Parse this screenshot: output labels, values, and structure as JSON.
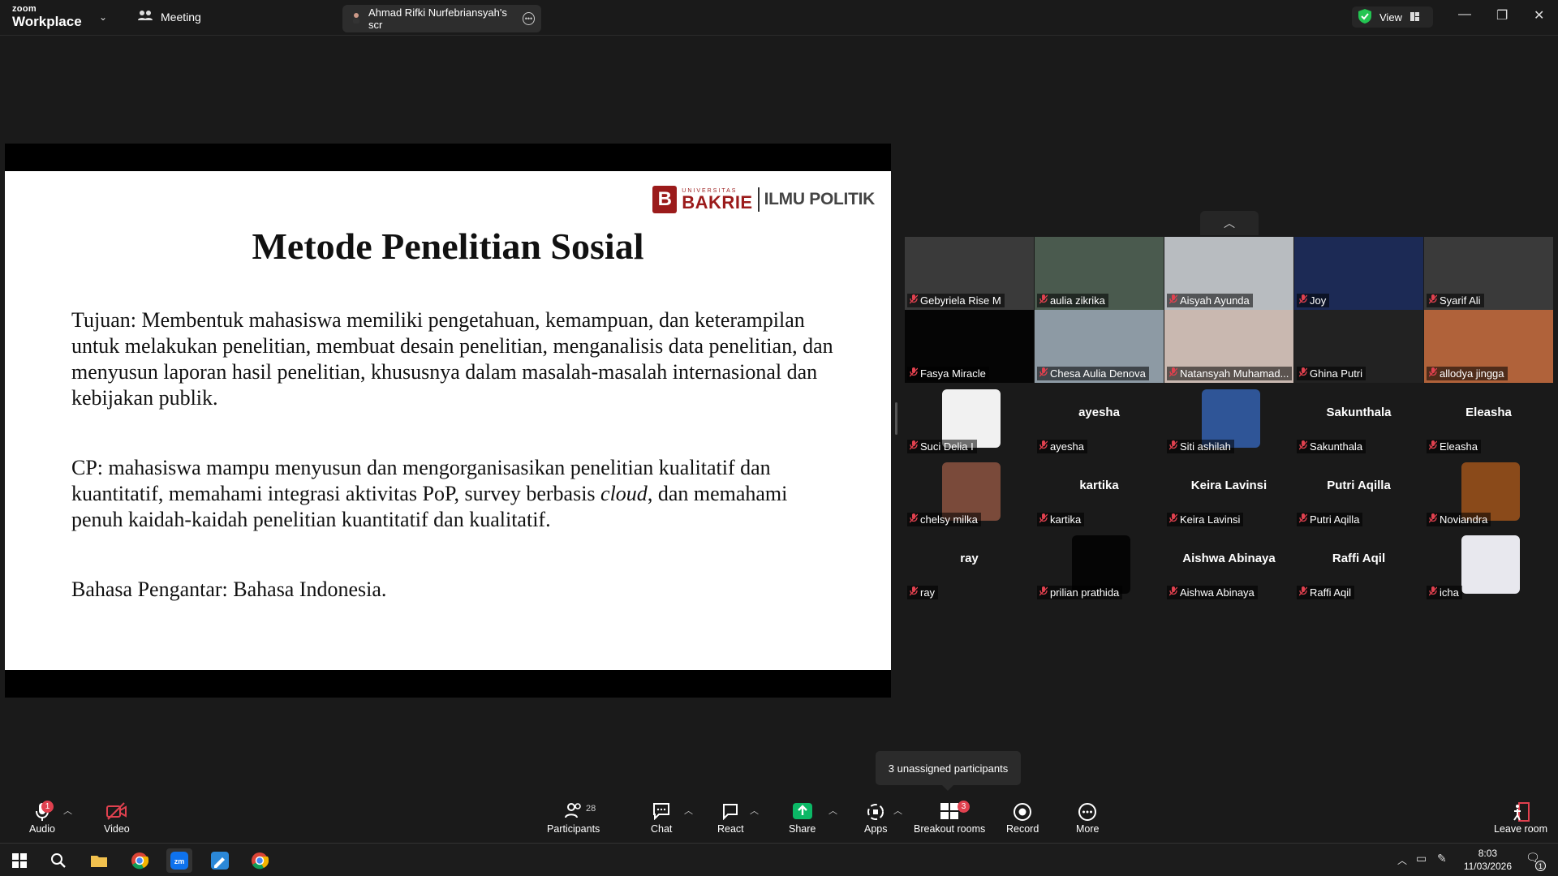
{
  "titlebar": {
    "logo_top": "zoom",
    "logo_bottom": "Workplace",
    "meeting_label": "Meeting",
    "share_tab_label": "Ahmad Rifki Nurfebriansyah's scr",
    "view_label": "View"
  },
  "slide": {
    "logo_small": "UNIVERSITAS",
    "logo_big": "BAKRIE",
    "logo_dept": "ILMU POLITIK",
    "title": "Metode Penelitian Sosial",
    "p1": "Tujuan: Membentuk mahasiswa memiliki pengetahuan, kemampuan, dan keterampilan untuk melakukan penelitian, membuat desain penelitian, menganalisis data penelitian, dan menyusun laporan hasil penelitian, khususnya dalam masalah-masalah internasional dan kebijakan publik.",
    "p2_before": "CP: mahasiswa mampu menyusun dan mengorganisasikan penelitian kualitatif dan kuantitatif, memahami integrasi aktivitas PoP, survey berbasis ",
    "p2_italic": "cloud",
    "p2_after": ", dan memahami penuh kaidah-kaidah penelitian kuantitatif  dan kualitatif.",
    "p3": "Bahasa Pengantar: Bahasa Indonesia."
  },
  "participants": [
    {
      "name": "Gebyriela Rise M",
      "type": "video",
      "color": "#3a3a3a"
    },
    {
      "name": "aulia zikrika",
      "type": "video",
      "color": "#4a5a4e"
    },
    {
      "name": "Aisyah Ayunda",
      "type": "video",
      "color": "#b8bcc0"
    },
    {
      "name": "Joy",
      "type": "video",
      "color": "#1c2a55"
    },
    {
      "name": "Syarif Ali",
      "type": "video",
      "color": "#3a3a3a"
    },
    {
      "name": "Fasya Miracle",
      "type": "video",
      "color": "#050505"
    },
    {
      "name": "Chesa Aulia Denova",
      "type": "video",
      "color": "#8d9aa4"
    },
    {
      "name": "Natansyah Muhamad...",
      "type": "video",
      "color": "#c9b8b0"
    },
    {
      "name": "Ghina Putri",
      "type": "video",
      "color": "#222222"
    },
    {
      "name": "allodya jingga",
      "type": "video",
      "color": "#b0623a"
    },
    {
      "name": "Suci Delia I",
      "type": "avatar",
      "color": "#f1f1f1"
    },
    {
      "name": "ayesha",
      "type": "text",
      "big": "ayesha"
    },
    {
      "name": "Siti ashilah",
      "type": "avatar",
      "color": "#2f5597"
    },
    {
      "name": "Sakunthala",
      "type": "text",
      "big": "Sakunthala"
    },
    {
      "name": "Eleasha",
      "type": "text",
      "big": "Eleasha"
    },
    {
      "name": "chelsy milka",
      "type": "avatar",
      "color": "#7a4a3a"
    },
    {
      "name": "kartika",
      "type": "text",
      "big": "kartika"
    },
    {
      "name": "Keira Lavinsi",
      "type": "text",
      "big": "Keira Lavinsi"
    },
    {
      "name": "Putri Aqilla",
      "type": "text",
      "big": "Putri Aqilla"
    },
    {
      "name": "Noviandra",
      "type": "avatar",
      "color": "#8a4a1a"
    },
    {
      "name": "ray",
      "type": "text",
      "big": "ray"
    },
    {
      "name": "prilian prathida",
      "type": "avatar",
      "color": "#050505"
    },
    {
      "name": "Aishwa Abinaya",
      "type": "text",
      "big": "Aishwa Abinaya"
    },
    {
      "name": "Raffi Aqil",
      "type": "text",
      "big": "Raffi Aqil"
    },
    {
      "name": "icha",
      "type": "avatar",
      "color": "#e8e8ee"
    }
  ],
  "tooltip": "3 unassigned participants",
  "toolbar": {
    "audio": "Audio",
    "audio_badge": "1",
    "video": "Video",
    "participants": "Participants",
    "participants_count": "28",
    "chat": "Chat",
    "react": "React",
    "share": "Share",
    "apps": "Apps",
    "breakout": "Breakout rooms",
    "breakout_badge": "3",
    "record": "Record",
    "more": "More",
    "leave": "Leave room"
  },
  "taskbar": {
    "time": "8:03",
    "date": "11/03/2026",
    "notif": "1"
  },
  "colors": {
    "accent": "#0e72ed",
    "mic_off": "#e0414f",
    "share_green": "#0bb866",
    "secure_green": "#23c552",
    "slide_red": "#9b1b1b"
  }
}
